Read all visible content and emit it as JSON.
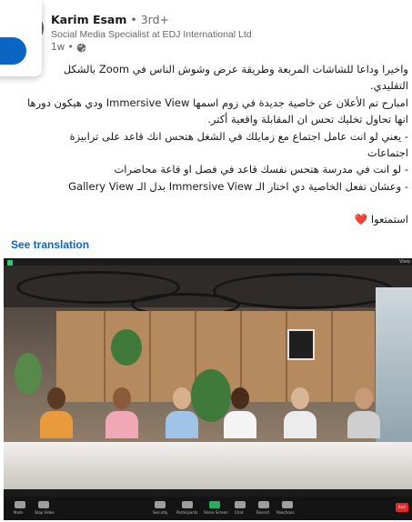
{
  "post": {
    "author": "Karim Esam",
    "degree": "• 3rd+",
    "headline": "Social Media Specialist at EDJ International Ltd",
    "time": "1w •",
    "time_icon": "globe-icon",
    "lines": [
      "واخيرا وداعا للشاشات المربعة وطريقة عرض وشوش الناس في Zoom بالشكل",
      "التقليدي.",
      "امبارح تم الأعلان عن خاصية جديدة في زوم اسمها Immersive View ودي هيكون دورها",
      "انها تحاول تخليك تحس ان المقابلة واقعية أكتر.",
      "- يعني لو انت عامل اجتماع مع زمايلك في الشغل هتحس انك قاعد على ترابيزة",
      "اجتماعات",
      "- لو انت في مدرسة هتحس نفسك قاعد في فصل او قاعة محاضرات",
      "- وعشان تفعل الخاصية دي اختار الـ Immersive View بدل الـ Gallery View"
    ],
    "closing": "استمتعوا",
    "closing_emoji": "❤️",
    "see_translation": "See translation"
  },
  "media": {
    "top_right_label": "View",
    "toolbar": [
      "Mute",
      "Stop Video",
      "Security",
      "Participants",
      "Share Screen",
      "Chat",
      "Record",
      "Reactions"
    ],
    "end_label": "End"
  },
  "colors": {
    "link": "#0a66c2",
    "heart": "#e0245e"
  }
}
